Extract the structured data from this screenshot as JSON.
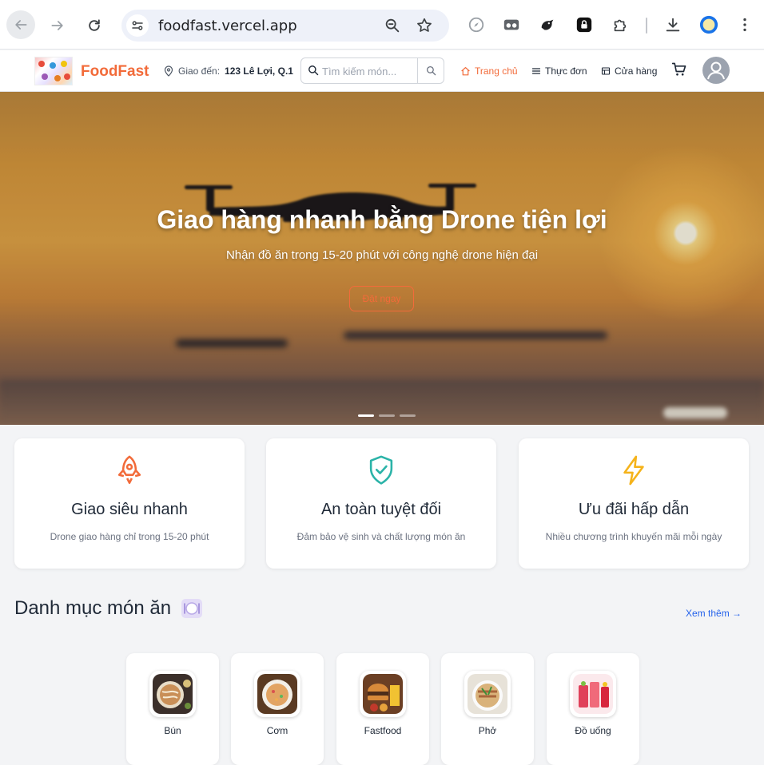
{
  "browser": {
    "url": "foodfast.vercel.app"
  },
  "header": {
    "brand": "FoodFast",
    "deliver_prefix": "Giao đến:",
    "deliver_address": "123 Lê Lợi, Q.1",
    "search_placeholder": "Tìm kiếm món...",
    "nav": {
      "home": "Trang chủ",
      "menu": "Thực đơn",
      "stores": "Cửa hàng"
    }
  },
  "hero": {
    "title": "Giao hàng nhanh bằng Drone tiện lợi",
    "subtitle": "Nhận đồ ăn trong 15-20 phút với công nghệ drone hiện đại",
    "cta": "Đặt ngay",
    "slide_count": 3,
    "active_slide": 1
  },
  "features": [
    {
      "title": "Giao siêu nhanh",
      "desc": "Drone giao hàng chỉ trong 15-20 phút",
      "icon": "rocket-icon",
      "color": "#f26b3a"
    },
    {
      "title": "An toàn tuyệt đối",
      "desc": "Đảm bảo vệ sinh và chất lượng món ăn",
      "icon": "shield-check-icon",
      "color": "#2bb3a8"
    },
    {
      "title": "Ưu đãi hấp dẫn",
      "desc": "Nhiều chương trình khuyến mãi mỗi ngày",
      "icon": "lightning-icon",
      "color": "#f5b31b"
    }
  ],
  "categories_section": {
    "title": "Danh mục món ăn",
    "more": "Xem thêm →",
    "items": [
      {
        "label": "Bún"
      },
      {
        "label": "Cơm"
      },
      {
        "label": "Fastfood"
      },
      {
        "label": "Phở"
      },
      {
        "label": "Đồ uống"
      }
    ]
  },
  "colors": {
    "accent": "#f26b3a",
    "link": "#2563eb"
  }
}
